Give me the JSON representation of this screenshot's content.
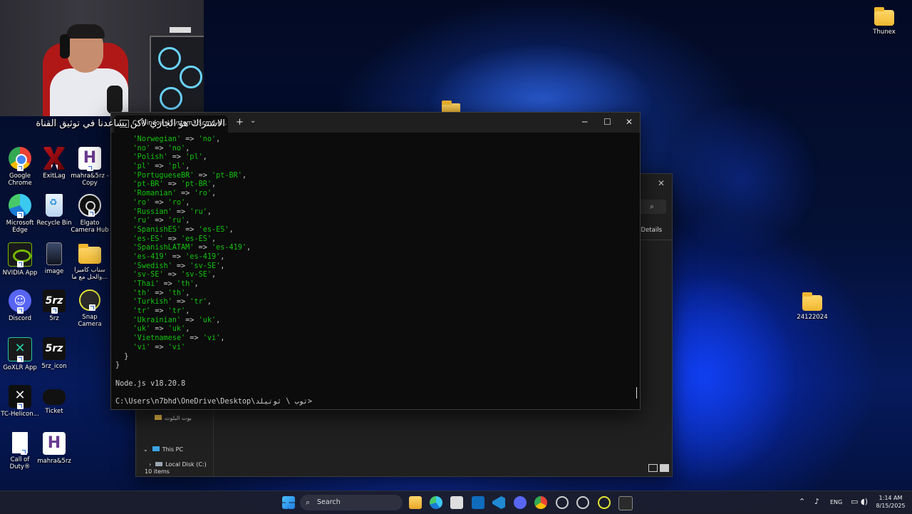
{
  "webcam_caption": "الاشتراك هو الجاري لأكن يساعدنا في توثيق القناة",
  "desktop_icons": [
    {
      "id": "chrome",
      "label": "Google Chrome"
    },
    {
      "id": "exitlag",
      "label": "ExitLag"
    },
    {
      "id": "mahra-copy",
      "label": "mahra&5rz - Copy"
    },
    {
      "id": "edge",
      "label": "Microsoft Edge"
    },
    {
      "id": "recycle",
      "label": "Recycle Bin"
    },
    {
      "id": "elgato",
      "label": "Elgato Camera Hub"
    },
    {
      "id": "nvidia",
      "label": "NVIDIA App"
    },
    {
      "id": "image",
      "label": "image"
    },
    {
      "id": "snap-folder",
      "label": "سناب كاميرا والحل مع ما..."
    },
    {
      "id": "discord",
      "label": "Discord"
    },
    {
      "id": "5rz",
      "label": "5rz"
    },
    {
      "id": "snapcamera",
      "label": "Snap Camera"
    },
    {
      "id": "goxlr",
      "label": "GoXLR App"
    },
    {
      "id": "5rz-icon",
      "label": "5rz_icon"
    },
    {
      "id": "tchelicon",
      "label": "TC-Helicon..."
    },
    {
      "id": "ticket",
      "label": "Ticket"
    },
    {
      "id": "cod",
      "label": "Call of Duty®"
    },
    {
      "id": "mahra",
      "label": "mahra&5rz"
    },
    {
      "id": "thunex",
      "label": "Thunex"
    },
    {
      "id": "folder-24122024",
      "label": "24122024"
    }
  ],
  "explorer": {
    "details_label": "Details",
    "nav_items": [
      "بوت البلوت",
      "This PC",
      "Local Disk (C:)"
    ],
    "status": "10 items"
  },
  "terminal": {
    "tab_title": "C:\\Windows\\System32\\cmd.e...",
    "lines": [
      {
        "pre": "  ",
        "k": "'Norwegian'",
        "v": "'no'"
      },
      {
        "pre": "  ",
        "k": "'no'",
        "v": "'no'"
      },
      {
        "pre": "  ",
        "k": "'Polish'",
        "v": "'pl'"
      },
      {
        "pre": "  ",
        "k": "'pl'",
        "v": "'pl'"
      },
      {
        "pre": "  ",
        "k": "'PortugueseBR'",
        "v": "'pt-BR'"
      },
      {
        "pre": "  ",
        "k": "'pt-BR'",
        "v": "'pt-BR'"
      },
      {
        "pre": "  ",
        "k": "'Romanian'",
        "v": "'ro'"
      },
      {
        "pre": "  ",
        "k": "'ro'",
        "v": "'ro'"
      },
      {
        "pre": "  ",
        "k": "'Russian'",
        "v": "'ru'"
      },
      {
        "pre": "  ",
        "k": "'ru'",
        "v": "'ru'"
      },
      {
        "pre": "  ",
        "k": "'SpanishES'",
        "v": "'es-ES'"
      },
      {
        "pre": "  ",
        "k": "'es-ES'",
        "v": "'es-ES'"
      },
      {
        "pre": "  ",
        "k": "'SpanishLATAM'",
        "v": "'es-419'"
      },
      {
        "pre": "  ",
        "k": "'es-419'",
        "v": "'es-419'"
      },
      {
        "pre": "  ",
        "k": "'Swedish'",
        "v": "'sv-SE'"
      },
      {
        "pre": "  ",
        "k": "'sv-SE'",
        "v": "'sv-SE'"
      },
      {
        "pre": "  ",
        "k": "'Thai'",
        "v": "'th'"
      },
      {
        "pre": "  ",
        "k": "'th'",
        "v": "'th'"
      },
      {
        "pre": "  ",
        "k": "'Turkish'",
        "v": "'tr'"
      },
      {
        "pre": "  ",
        "k": "'tr'",
        "v": "'tr'"
      },
      {
        "pre": "  ",
        "k": "'Ukrainian'",
        "v": "'uk'"
      },
      {
        "pre": "  ",
        "k": "'uk'",
        "v": "'uk'"
      },
      {
        "pre": "  ",
        "k": "'Vietnamese'",
        "v": "'vi'"
      },
      {
        "pre": "  ",
        "k": "'vi'",
        "v": "'vi'",
        "last": true
      }
    ],
    "close_inner": "  }",
    "close_outer": "}",
    "node_version": "Node.js v18.20.8",
    "prompt": "C:\\Users\\n7bhd\\OneDrive\\Desktop\\توب \\ ثوتيلد>"
  },
  "taskbar": {
    "search_placeholder": "Search",
    "lang": "ENG",
    "time": "1:14 AM",
    "date": "8/15/2025"
  }
}
